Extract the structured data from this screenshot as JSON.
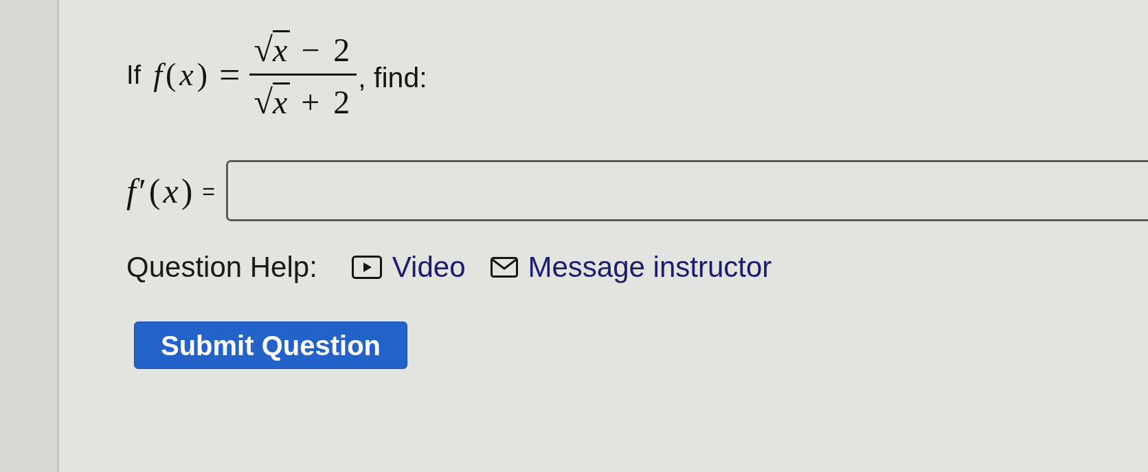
{
  "question": {
    "prefix": "If",
    "lhs": "*f*(*x*)",
    "equals": "=",
    "fraction": {
      "numerator": {
        "radical": "√",
        "radicand": "x",
        "tail": "− 2"
      },
      "denominator": {
        "radical": "√",
        "radicand": "x",
        "tail": "+ 2"
      }
    },
    "suffix": ", find:"
  },
  "answer": {
    "label": "*f*′(*x*)",
    "equals": "="
  },
  "help": {
    "label": "Question Help:",
    "links": [
      {
        "kind": "video",
        "label": "Video"
      },
      {
        "kind": "message",
        "label": "Message instructor"
      }
    ]
  },
  "submit_button": {
    "label": "Submit Question"
  }
}
